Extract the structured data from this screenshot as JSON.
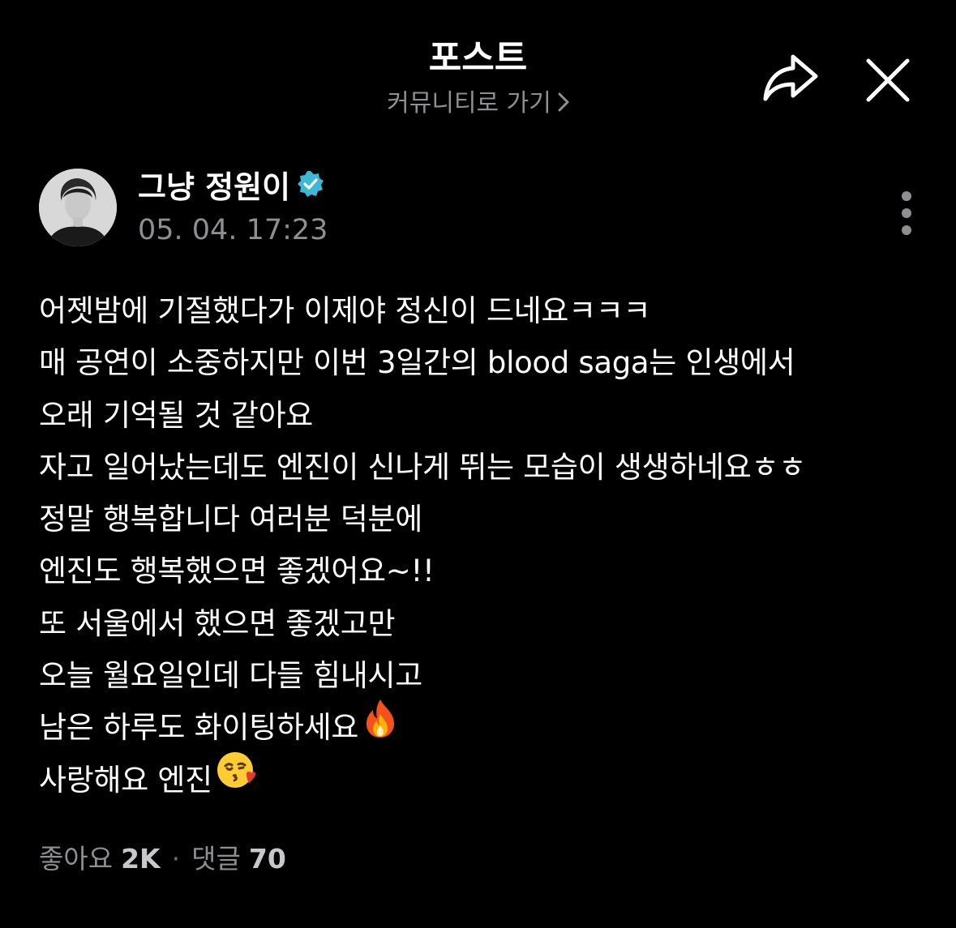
{
  "header": {
    "title": "포스트",
    "community_link": "커뮤니티로 가기"
  },
  "icons": {
    "share": "share-icon",
    "close": "close-icon",
    "more": "more-vertical-icon",
    "verified": "verified-badge-icon",
    "chevron": "chevron-right-icon"
  },
  "colors": {
    "background": "#000000",
    "text_primary": "#ffffff",
    "text_secondary": "#8e8e93",
    "verified": "#3fb8d8"
  },
  "author": {
    "name": "그냥 정원이",
    "time": "05. 04. 17:23"
  },
  "post": {
    "lines": [
      "어젯밤에 기절했다가 이제야 정신이 드네요ㅋㅋㅋ",
      "매 공연이 소중하지만 이번 3일간의 blood saga는 인생에서",
      "오래 기억될 것 같아요",
      "자고 일어났는데도 엔진이 신나게 뛰는 모습이 생생하네요ㅎㅎ",
      "정말 행복합니다 여러분 덕분에",
      "엔진도 행복했으면 좋겠어요~!!",
      "또 서울에서 했으면 좋겠고만",
      "오늘 월요일인데 다들 힘내시고",
      "남은 하루도 화이팅하세요",
      "사랑해요 엔진"
    ],
    "emoji_fire": "fire-emoji",
    "emoji_kiss": "face-blowing-kiss-emoji"
  },
  "stats": {
    "likes_label": "좋아요",
    "likes_count": "2K",
    "separator": "·",
    "comments_label": "댓글",
    "comments_count": "70"
  }
}
